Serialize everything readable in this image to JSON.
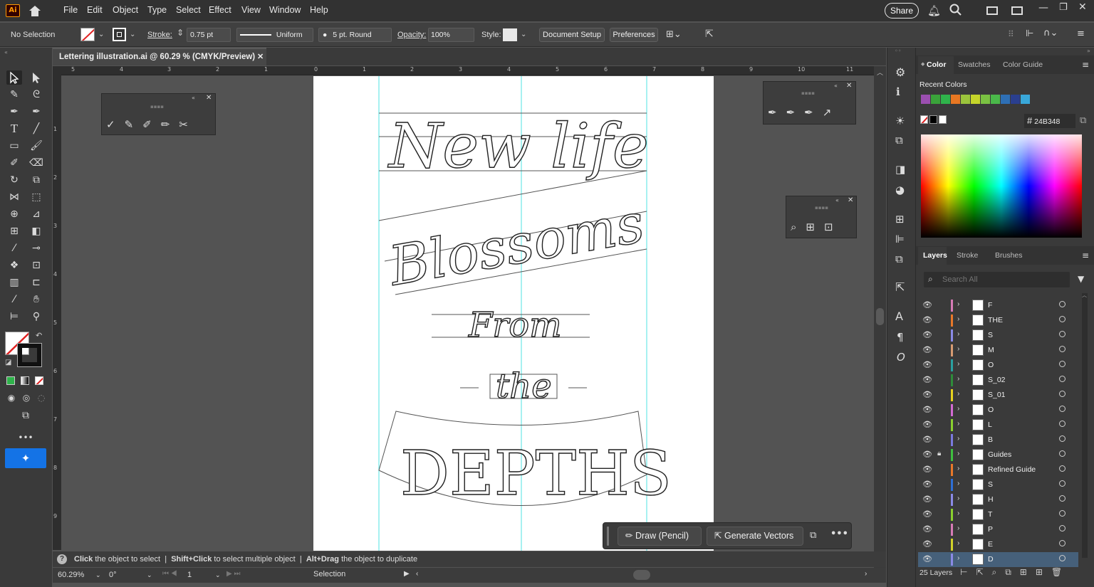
{
  "app": {
    "logo": "Ai"
  },
  "menu": [
    "File",
    "Edit",
    "Object",
    "Type",
    "Select",
    "Effect",
    "View",
    "Window",
    "Help"
  ],
  "share_label": "Share",
  "control": {
    "selection": "No Selection",
    "stroke_label": "Stroke:",
    "stroke_value": "0.75 pt",
    "profile": "Uniform",
    "brush": "5 pt. Round",
    "opacity_label": "Opacity:",
    "opacity_value": "100%",
    "style_label": "Style:",
    "document_setup": "Document Setup",
    "preferences": "Preferences"
  },
  "document_tab": {
    "title": "Lettering illustration.ai @ 60.29 % (CMYK/Preview)",
    "close": "✕"
  },
  "ruler": {
    "h": [
      "5",
      "4",
      "3",
      "2",
      "1",
      "0",
      "1",
      "2",
      "3",
      "4",
      "5",
      "6",
      "7",
      "8",
      "9",
      "10",
      "11"
    ],
    "v": [
      "1",
      "2",
      "3",
      "4",
      "5",
      "6",
      "7",
      "8",
      "9",
      "1"
    ]
  },
  "artwork": {
    "line1": "New life",
    "line2": "Blossoms",
    "line3": "From",
    "line4": "the",
    "line5": "DEPTHS"
  },
  "status": {
    "help_icon": "?",
    "hint1_bold": "Click",
    "hint1": "the object to select",
    "hint2_bold": "Shift+Click",
    "hint2": "to select multiple object",
    "hint3_bold": "Alt+Drag",
    "hint3": "the object to duplicate"
  },
  "bottom": {
    "zoom": "60.29%",
    "rotate": "0°",
    "artboard": "1",
    "mode": "Selection"
  },
  "context_bar": {
    "draw": "Draw (Pencil)",
    "generate": "Generate Vectors",
    "more": "•••"
  },
  "color_panel": {
    "tabs": [
      "Color",
      "Swatches",
      "Color Guide"
    ],
    "recent_label": "Recent Colors",
    "hex": "24B348",
    "recent_colors": [
      "#9b4fb0",
      "#3aa33a",
      "#2fb34b",
      "#e87722",
      "#9bc43c",
      "#c5d52a",
      "#7ac142",
      "#4ab84a",
      "#2e6fb5",
      "#2a3f8f",
      "#39a7d9"
    ]
  },
  "layers_panel": {
    "tabs": [
      "Layers",
      "Stroke",
      "Brushes"
    ],
    "search_placeholder": "Search All",
    "count": "25 Layers",
    "rows": [
      {
        "name": "F",
        "color": "#d77bb6"
      },
      {
        "name": "THE",
        "color": "#e8782a"
      },
      {
        "name": "S",
        "color": "#8a8ae6"
      },
      {
        "name": "M",
        "color": "#d79b72"
      },
      {
        "name": "O",
        "color": "#2aa0a0"
      },
      {
        "name": "S_02",
        "color": "#2e8b3a"
      },
      {
        "name": "S_01",
        "color": "#e6d21f"
      },
      {
        "name": "O",
        "color": "#d26bd2"
      },
      {
        "name": "L",
        "color": "#8ad12e"
      },
      {
        "name": "B",
        "color": "#7a7adf"
      },
      {
        "name": "Guides",
        "color": "#3fbf3f"
      },
      {
        "name": "Refined Guide",
        "color": "#e8782a"
      },
      {
        "name": "S",
        "color": "#2e6fd6"
      },
      {
        "name": "H",
        "color": "#8a8ae6"
      },
      {
        "name": "T",
        "color": "#8ad12e"
      },
      {
        "name": "P",
        "color": "#d77bb6"
      },
      {
        "name": "E",
        "color": "#d2d22a"
      },
      {
        "name": "D",
        "color": "#8a8ae6"
      }
    ]
  }
}
